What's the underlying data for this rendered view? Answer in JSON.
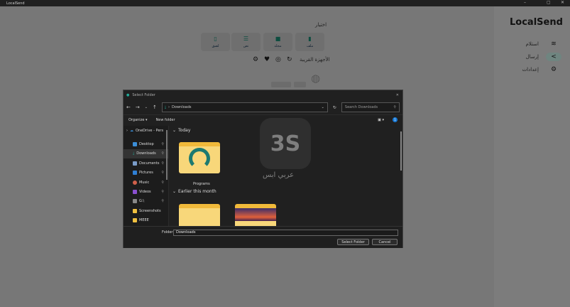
{
  "window": {
    "title": "LocalSend",
    "minimize": "–",
    "maximize": "▢",
    "close": "✕"
  },
  "sidebar": {
    "brand": "LocalSend",
    "items": [
      {
        "label": "استلام",
        "icon": "wifi-icon"
      },
      {
        "label": "إرسال",
        "icon": "send-icon"
      },
      {
        "label": "إعدادات",
        "icon": "gear-icon"
      }
    ]
  },
  "send": {
    "selection_label": "اختيار",
    "buttons": [
      {
        "label": "ملف"
      },
      {
        "label": "مجلد"
      },
      {
        "label": "نص"
      },
      {
        "label": "لصق"
      }
    ],
    "nearby_label": "الأجهزة القريبة"
  },
  "dialog": {
    "title": "Select Folder",
    "path": "Downloads",
    "search_placeholder": "Search Downloads",
    "organize": "Organize ▾",
    "new_folder": "New folder",
    "nav_items": [
      {
        "label": "OneDrive - Pers"
      },
      {
        "label": "Desktop"
      },
      {
        "label": "Downloads"
      },
      {
        "label": "Documents"
      },
      {
        "label": "Pictures"
      },
      {
        "label": "Music"
      },
      {
        "label": "Videos"
      },
      {
        "label": "G:\\"
      },
      {
        "label": "Screenshots"
      },
      {
        "label": "MEEE"
      }
    ],
    "groups": [
      {
        "label": "Today"
      },
      {
        "label": "Earlier this month"
      }
    ],
    "files": [
      {
        "name": "Programs"
      }
    ],
    "folder_label": "Folder:",
    "folder_value": "Downloads",
    "select_button": "Select Folder",
    "cancel_button": "Cancel",
    "badge": "1"
  },
  "watermark": {
    "text": "عربي ابس"
  }
}
